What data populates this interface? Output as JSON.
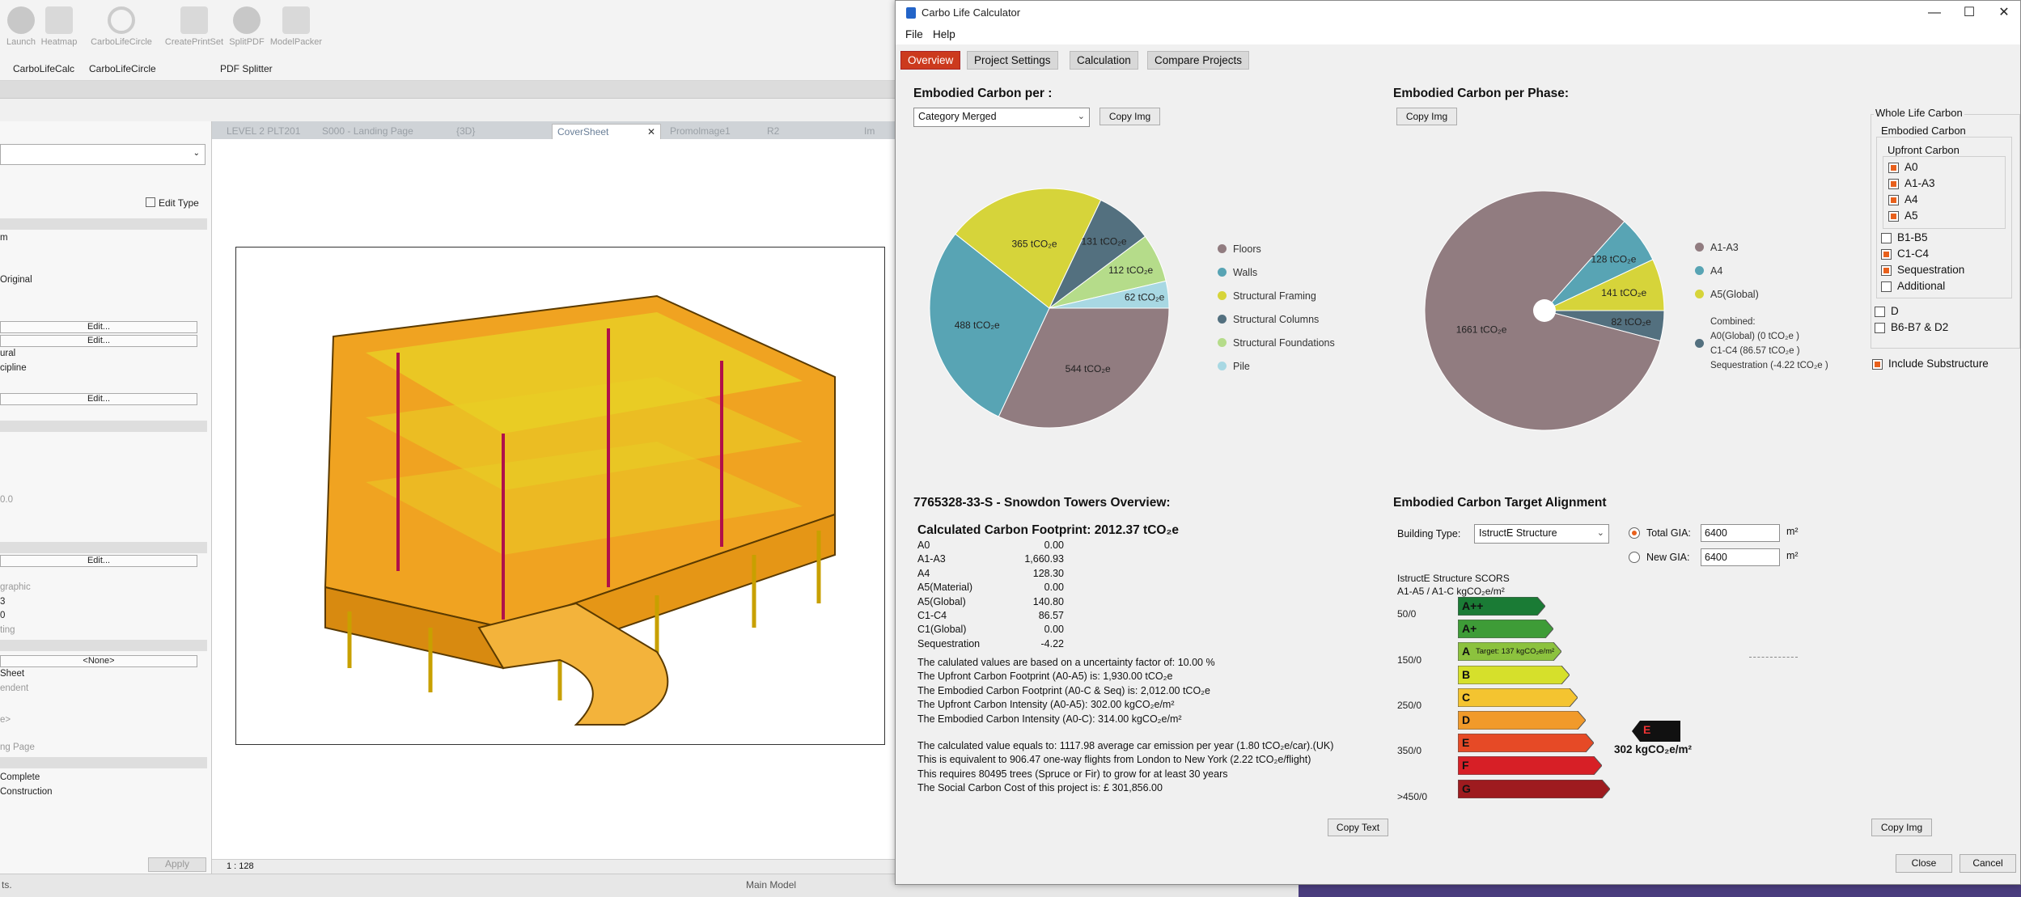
{
  "bg": {
    "ribbon_buttons": [
      "Launch",
      "Heatmap",
      "CarboLifeCircle",
      "CreatePrintSet",
      "SplitPDF",
      "ModelPacker"
    ],
    "ribbon_groups": [
      "CarboLifeCalc",
      "CarboLifeCircle",
      "PDF Splitter"
    ],
    "edit_type": "Edit Type",
    "props": {
      "frag_m": "m",
      "frag_original": "Original",
      "edit": "Edit...",
      "frag_ural": "ural",
      "frag_cipline": "cipline",
      "frag_00": "0.0",
      "frag_graphic": "graphic",
      "frag_3": "3",
      "frag_0": "0",
      "frag_ting": "ting",
      "none": "<None>",
      "frag_sheet": "Sheet",
      "frag_endent": "endent",
      "frag_e": "e>",
      "frag_ngpage": "ng Page",
      "frag_complete": "Complete",
      "frag_construction": "Construction"
    },
    "view_tabs": [
      "LEVEL 2 PLT201",
      "S000 - Landing Page",
      "{3D}",
      "CoverSheet",
      "Promolmage1",
      "R2",
      "Im"
    ],
    "apply": "Apply",
    "scale": "1 : 128",
    "status_left": "ts.",
    "main_model": "Main Model"
  },
  "window": {
    "title": "Carbo Life Calculator",
    "menu": [
      "File",
      "Help"
    ],
    "tabs": [
      "Overview",
      "Project Settings",
      "Calculation",
      "Compare Projects"
    ],
    "left_chart": {
      "heading": "Embodied Carbon per :",
      "combo": "Category Merged",
      "copy": "Copy Img",
      "slice_labels": [
        "544 tCO₂e",
        "488 tCO₂e",
        "365 tCO₂e",
        "131 tCO₂e",
        "112 tCO₂e",
        "62 tCO₂e"
      ]
    },
    "right_chart": {
      "heading": "Embodied Carbon per Phase:",
      "copy": "Copy Img",
      "slice_labels": [
        "1661 tCO₂e",
        "128 tCO₂e",
        "141 tCO₂e",
        "82 tCO₂e"
      ],
      "legend_combined_title": "Combined:",
      "legend_combined_lines": [
        "A0(Global) (0 tCO₂e )",
        "C1-C4 (86.57 tCO₂e )",
        "Sequestration (-4.22 tCO₂e )"
      ]
    },
    "wlc": {
      "title": "Whole Life Carbon",
      "embodied": "Embodied Carbon",
      "upfront": "Upfront Carbon",
      "items_upfront": [
        {
          "label": "A0",
          "checked": true
        },
        {
          "label": "A1-A3",
          "checked": true
        },
        {
          "label": "A4",
          "checked": true
        },
        {
          "label": "A5",
          "checked": true
        }
      ],
      "items_embodied": [
        {
          "label": "B1-B5",
          "checked": false
        },
        {
          "label": "C1-C4",
          "checked": true
        },
        {
          "label": "Sequestration",
          "checked": true
        },
        {
          "label": "Additional",
          "checked": false
        }
      ],
      "items_wlc": [
        {
          "label": "D",
          "checked": false
        },
        {
          "label": "B6-B7 & D2",
          "checked": false
        }
      ],
      "include_substructure": "Include Substructure"
    },
    "overview": {
      "heading": "7765328-33-S - Snowdon Towers Overview:",
      "footprint": "Calculated Carbon Footprint: 2012.37 tCO₂e",
      "rows": [
        [
          "A0",
          "0.00"
        ],
        [
          "A1-A3",
          "1,660.93"
        ],
        [
          "A4",
          "128.30"
        ],
        [
          "A5(Material)",
          "0.00"
        ],
        [
          "A5(Global)",
          "140.80"
        ],
        [
          "C1-C4",
          "86.57"
        ],
        [
          "C1(Global)",
          "0.00"
        ],
        [
          "Sequestration",
          "-4.22"
        ]
      ],
      "para1": [
        "The calulated values are based on a uncertainty factor of: 10.00 %",
        "The Upfront Carbon Footprint (A0-A5) is: 1,930.00 tCO₂e",
        "The Embodied Carbon Footprint (A0-C & Seq) is: 2,012.00 tCO₂e",
        "The Upfront Carbon Intensity (A0-A5): 302.00 kgCO₂e/m²",
        "The Embodied Carbon Intensity (A0-C): 314.00 kgCO₂e/m²"
      ],
      "para2": [
        "The calculated value equals to: 1117.98 average car emission per year (1.80 tCO₂e/car).(UK)",
        "This is equivalent to 906.47 one-way flights from London to New York (2.22 tCO₂e/flight)",
        "This requires 80495 trees (Spruce or Fir) to grow for at least 30 years",
        "The Social Carbon Cost of this project is: £ 301,856.00"
      ],
      "copy_text": "Copy Text"
    },
    "target": {
      "heading": "Embodied Carbon Target Alignment",
      "building_type_label": "Building Type:",
      "building_type": "IstructE Structure",
      "total_gia_label": "Total GIA:",
      "total_gia": "6400",
      "new_gia_label": "New GIA:",
      "new_gia": "6400",
      "unit": "m²",
      "scors_title": "IstructE Structure SCORS",
      "scors_sub": "A1-A5 / A1-C kgCO₂e/m²",
      "y_labels": [
        "50/0",
        "150/0",
        "250/0",
        "350/0",
        ">450/0"
      ],
      "bands": [
        "A++",
        "A+",
        "A",
        "B",
        "C",
        "D",
        "E",
        "F",
        "G"
      ],
      "target_note": "Target: 137 kgCO₂e/m²",
      "marker": "E",
      "result": "302 kgCO₂e/m²",
      "copy": "Copy Img"
    },
    "close": "Close",
    "cancel": "Cancel"
  },
  "chart_data": [
    {
      "type": "pie",
      "title": "Embodied Carbon per :",
      "categories": [
        "Floors",
        "Walls",
        "Structural Framing",
        "Structural Columns",
        "Structural Foundations",
        "Pile"
      ],
      "values": [
        544,
        488,
        365,
        131,
        112,
        62
      ],
      "unit": "tCO₂e",
      "colors": [
        "#917c80",
        "#58a4b4",
        "#d6d43a",
        "#53707f",
        "#b5dc8a",
        "#a8d8e3"
      ],
      "legend": "right"
    },
    {
      "type": "pie",
      "title": "Embodied Carbon per Phase:",
      "categories": [
        "A1-A3",
        "A4",
        "A5(Global)",
        "Combined:"
      ],
      "values": [
        1661,
        128,
        141,
        82
      ],
      "unit": "tCO₂e",
      "colors": [
        "#917c80",
        "#58a4b4",
        "#d6d43a",
        "#53707f"
      ],
      "legend": "right"
    }
  ],
  "colors": {
    "accent": "#cc3a1e",
    "checkbox": "#e8601c"
  }
}
